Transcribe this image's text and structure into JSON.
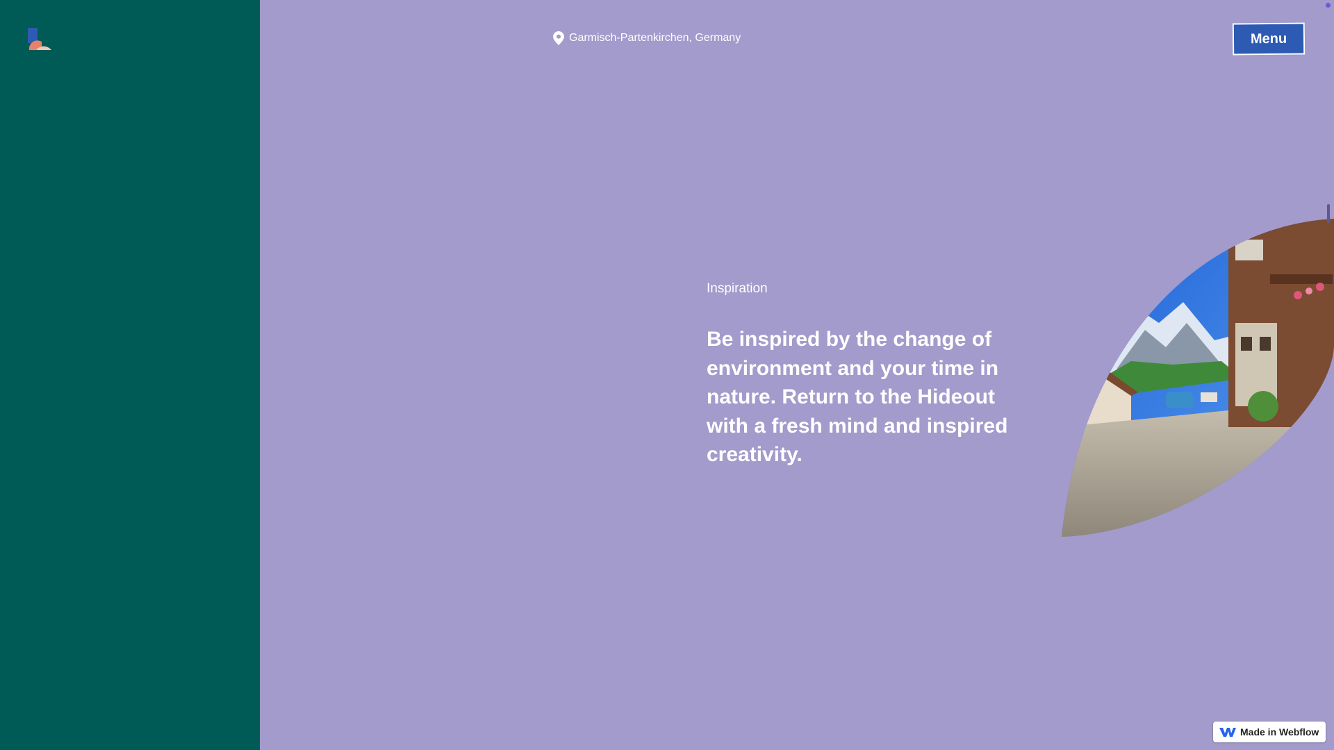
{
  "header": {
    "location_text": "Garmisch-Partenkirchen, Germany",
    "menu_label": "Menu"
  },
  "content": {
    "eyebrow": "Inspiration",
    "headline": "Be inspired by the change of environment and your time in nature. Return to the Hideout with a fresh mind and inspired creativity."
  },
  "badge": {
    "label": "Made in Webflow"
  },
  "icons": {
    "logo": "brand-logo-icon",
    "location": "map-pin-icon",
    "webflow": "webflow-logo-icon"
  },
  "colors": {
    "background": "#a39bcb",
    "sidebar": "#005a56",
    "menu_button": "#2d5bb3",
    "text": "#ffffff"
  }
}
